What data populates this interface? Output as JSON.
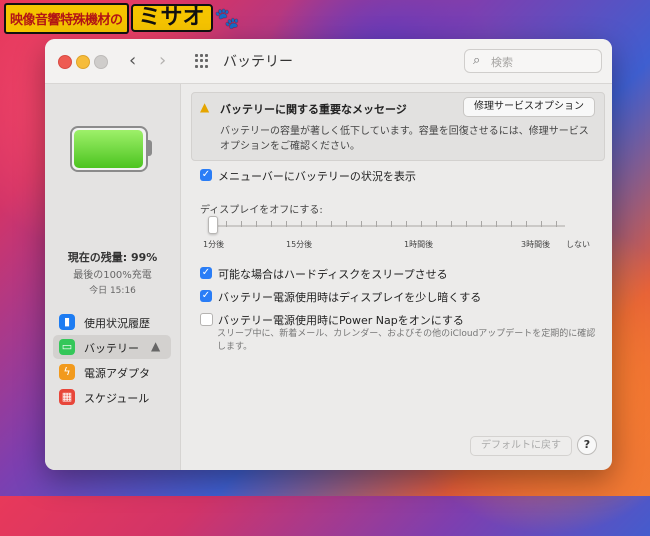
{
  "logo": {
    "text": "映像音響特殊機材の",
    "big": "ミサオ",
    "paw": "🐾"
  },
  "window": {
    "title": "バッテリー"
  },
  "search": {
    "placeholder": "検索"
  },
  "sidebar": {
    "level_percent": 99,
    "status": "現在の残量: 99%",
    "charge": "最後の100%充電",
    "time": "今日 15:16",
    "items": [
      {
        "label": "使用状況履歴",
        "icon": "bar-chart-icon",
        "color": "#1d7cf2"
      },
      {
        "label": "バッテリー",
        "icon": "battery-icon",
        "color": "#34c759",
        "warn": "▲"
      },
      {
        "label": "電源アダプタ",
        "icon": "bolt-icon",
        "color": "#f29a1d"
      },
      {
        "label": "スケジュール",
        "icon": "calendar-icon",
        "color": "#e8463a"
      }
    ]
  },
  "notice": {
    "title": "バッテリーに関する重要なメッセージ",
    "button": "修理サービスオプション",
    "body": "バッテリーの容量が著しく低下しています。容量を回復させるには、修理サービスオプションをご確認ください。"
  },
  "settings": {
    "menubar": "メニューバーにバッテリーの状況を表示",
    "slider_label": "ディスプレイをオフにする:",
    "slider_ticks": [
      "1分後",
      "15分後",
      "1時間後",
      "3時間後",
      "しない"
    ],
    "sleep_disk": "可能な場合はハードディスクをスリープさせる",
    "dim_display": "バッテリー電源使用時はディスプレイを少し暗くする",
    "power_nap": "バッテリー電源使用時にPower Napをオンにする",
    "power_nap_help": "スリープ中に、新着メール、カレンダー、およびその他のiCloudアップデートを定期的に確認します。"
  },
  "footer": {
    "default_button": "デフォルトに戻す",
    "help": "?"
  }
}
